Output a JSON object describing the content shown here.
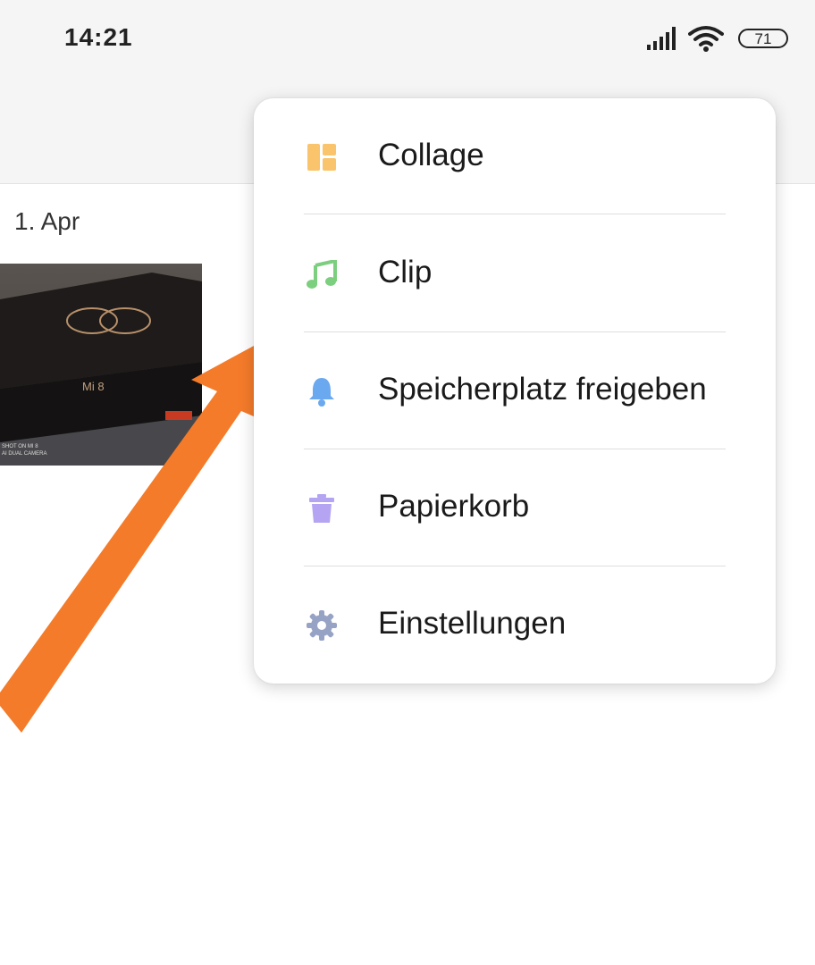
{
  "status_bar": {
    "time": "14:21",
    "battery_level": "71",
    "icons": [
      "signal-icon",
      "wifi-icon",
      "battery-icon"
    ]
  },
  "gallery": {
    "date_header": "1. Apr",
    "thumbnail": {
      "box_text": "Mi 8",
      "watermark_line1": "SHOT ON MI 8",
      "watermark_line2": "AI DUAL CAMERA"
    }
  },
  "menu": {
    "items": [
      {
        "label": "Collage",
        "icon": "collage-icon",
        "color": "#f9c46b"
      },
      {
        "label": "Clip",
        "icon": "music-note-icon",
        "color": "#7ccf7e"
      },
      {
        "label": "Speicherplatz freigeben",
        "icon": "bell-icon",
        "color": "#6aa8ef"
      },
      {
        "label": "Papierkorb",
        "icon": "trash-icon",
        "color": "#b5a4f2"
      },
      {
        "label": "Einstellungen",
        "icon": "gear-icon",
        "color": "#97a3c4"
      }
    ]
  },
  "annotation": {
    "arrow_color": "#f47b2a"
  }
}
